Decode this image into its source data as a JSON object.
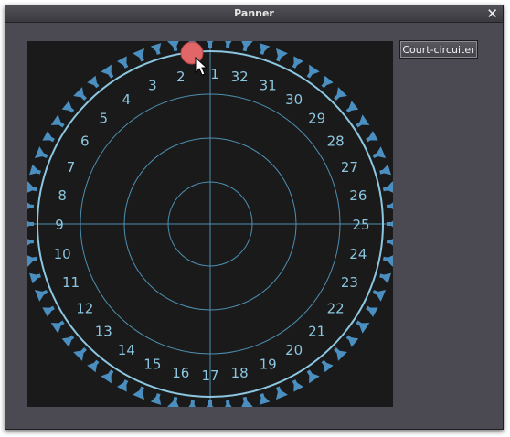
{
  "window": {
    "title": "Panner",
    "close_glyph": "✕"
  },
  "toolbar": {
    "bypass_label": "Court-circuiter"
  },
  "panner": {
    "speaker_labels": [
      "1",
      "2",
      "3",
      "4",
      "5",
      "6",
      "7",
      "8",
      "9",
      "10",
      "11",
      "12",
      "13",
      "14",
      "15",
      "16",
      "17",
      "18",
      "19",
      "20",
      "21",
      "22",
      "23",
      "24",
      "25",
      "26",
      "27",
      "28",
      "29",
      "30",
      "31",
      "32"
    ],
    "source": {
      "color": "#e06668"
    },
    "colors": {
      "background": "#1a1a1a",
      "outer_ring": "#8cc6e0",
      "grid": "#4d8fb0",
      "label": "#8cc6e0",
      "speaker": "#4a8fc0"
    }
  }
}
